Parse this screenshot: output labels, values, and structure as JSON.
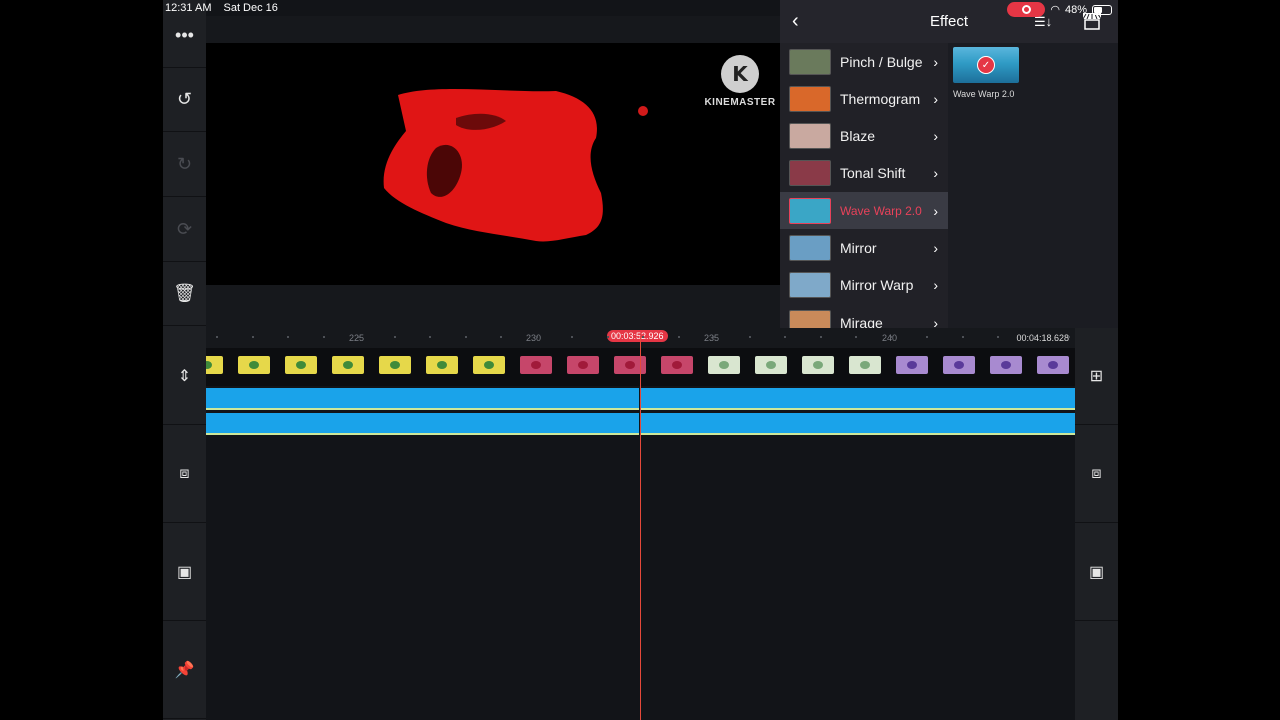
{
  "status_bar": {
    "time": "12:31 AM",
    "date": "Sat Dec 16",
    "battery": "48%",
    "battery_level": 0.48,
    "recording": true
  },
  "left_toolbar": {
    "items": [
      {
        "name": "more",
        "icon": "more-dots-icon",
        "glyph": "•••",
        "enabled": true
      },
      {
        "name": "undo",
        "icon": "undo-icon",
        "glyph": "↺",
        "enabled": true
      },
      {
        "name": "redo",
        "icon": "redo-icon",
        "glyph": "↻",
        "enabled": false
      },
      {
        "name": "restore",
        "icon": "restore-icon",
        "glyph": "⟳",
        "enabled": false
      },
      {
        "name": "delete",
        "icon": "trash-icon",
        "glyph": "🗑",
        "enabled": true
      }
    ]
  },
  "preview": {
    "watermark_logo": "K",
    "watermark_text": "KINEMASTER"
  },
  "effect_panel": {
    "title": "Effect",
    "items": [
      {
        "label": "Pinch / Bulge",
        "selected": false,
        "thumb": "#6a7a5c"
      },
      {
        "label": "Thermogram",
        "selected": false,
        "thumb": "#d9682a"
      },
      {
        "label": "Blaze",
        "selected": false,
        "thumb": "#c9a9a0"
      },
      {
        "label": "Tonal Shift",
        "selected": false,
        "thumb": "#8a3a48"
      },
      {
        "label": "Wave Warp 2.0",
        "selected": true,
        "thumb": "#3aa6c6"
      },
      {
        "label": "Mirror",
        "selected": false,
        "thumb": "#6a9ec4"
      },
      {
        "label": "Mirror Warp",
        "selected": false,
        "thumb": "#7fa9c9"
      },
      {
        "label": "Mirage",
        "selected": false,
        "thumb": "#c98a5a"
      }
    ],
    "selected_detail": {
      "label": "Wave Warp 2.0"
    }
  },
  "timeline": {
    "ruler_labels": [
      "225",
      "230",
      "235",
      "240"
    ],
    "current_time": "00:03:52.926",
    "end_time": "00:04:18.628",
    "left_buttons": [
      {
        "name": "track-height",
        "icon": "expand-vertical-icon",
        "glyph": "⇕"
      },
      {
        "name": "trim-start",
        "icon": "trim-start-icon",
        "glyph": "⧈"
      },
      {
        "name": "crop",
        "icon": "crop-icon",
        "glyph": "▣"
      },
      {
        "name": "pin",
        "icon": "pin-icon",
        "glyph": "📌"
      }
    ],
    "right_buttons": [
      {
        "name": "clip-gear",
        "icon": "clip-settings-icon",
        "glyph": "⊞"
      },
      {
        "name": "trim-end",
        "icon": "trim-end-icon",
        "glyph": "⧈"
      },
      {
        "name": "crop-end",
        "icon": "crop-end-icon",
        "glyph": "▣"
      }
    ],
    "frame_colors": [
      "#e6d84a",
      "#e6d84a",
      "#e6d84a",
      "#e6d84a",
      "#e6d84a",
      "#e6d84a",
      "#e6d84a",
      "#c6466a",
      "#c6466a",
      "#c6466a",
      "#c6466a",
      "#d9e6d0",
      "#d9e6d0",
      "#d9e6d0",
      "#d9e6d0",
      "#a88ad0",
      "#a88ad0",
      "#a88ad0",
      "#a88ad0"
    ]
  }
}
